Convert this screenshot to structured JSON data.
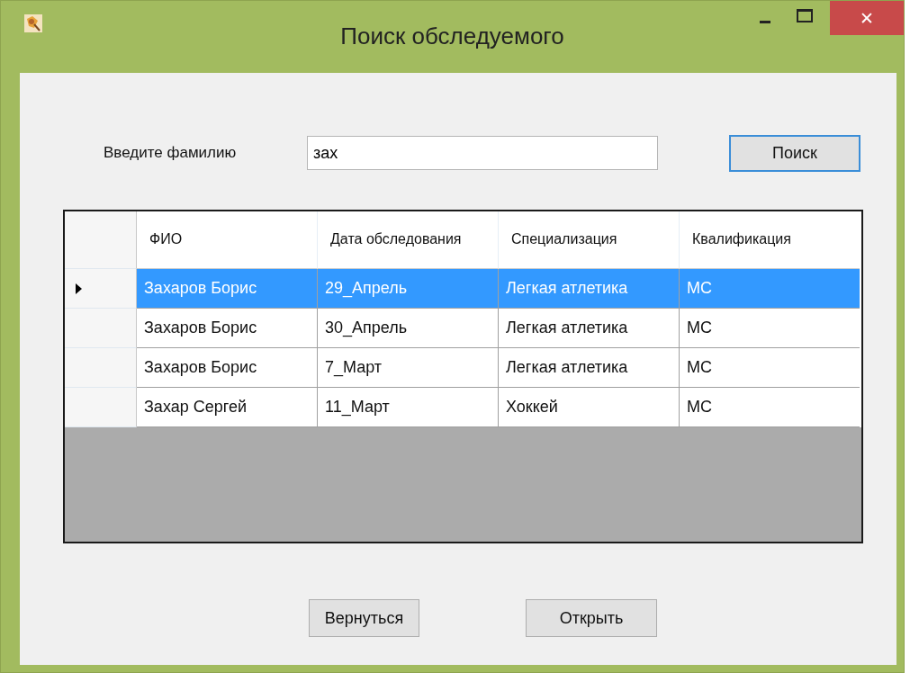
{
  "window": {
    "title": "Поиск обследуемого",
    "controls": [
      {
        "kind": "minimize"
      },
      {
        "kind": "maximize"
      },
      {
        "kind": "close",
        "label": "✕"
      }
    ]
  },
  "search": {
    "label": "Введите фамилию",
    "value": "зах",
    "button": "Поиск"
  },
  "table": {
    "columns": [
      "ФИО",
      "Дата обследования",
      "Специализация",
      "Квалификация"
    ],
    "rows": [
      {
        "selected": true,
        "cells": [
          "Захаров Борис",
          "29_Апрель",
          "Легкая атлетика",
          "МС"
        ]
      },
      {
        "selected": false,
        "cells": [
          "Захаров Борис",
          "30_Апрель",
          "Легкая атлетика",
          "МС"
        ]
      },
      {
        "selected": false,
        "cells": [
          "Захаров Борис",
          "7_Март",
          "Легкая атлетика",
          "МС"
        ]
      },
      {
        "selected": false,
        "cells": [
          "Захар Сергей",
          "11_Март",
          "Хоккей",
          "МС"
        ]
      }
    ]
  },
  "buttons": [
    "Вернуться",
    "Открыть"
  ]
}
